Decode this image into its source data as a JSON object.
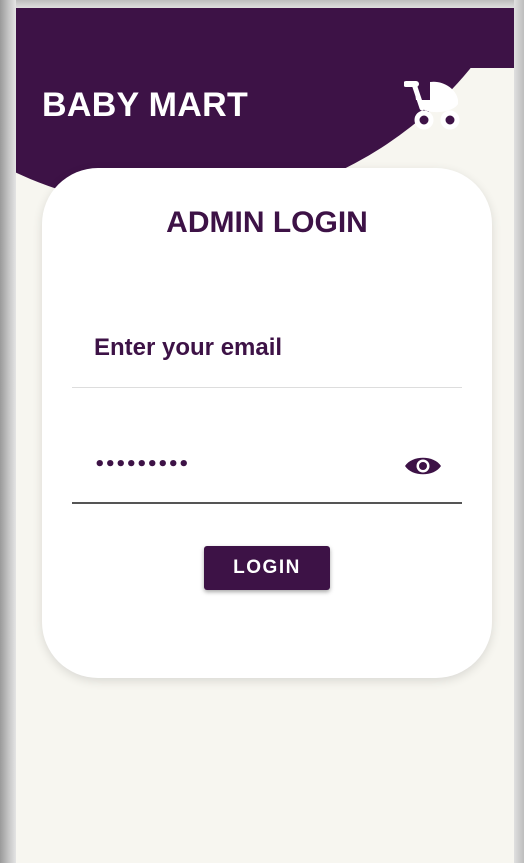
{
  "header": {
    "brand": "BABY MART",
    "cart_icon": "baby-stroller-icon"
  },
  "login": {
    "title": "ADMIN LOGIN",
    "email_placeholder": "Enter your email",
    "password_masked": "•••••••••",
    "password_toggle_icon": "eye-icon",
    "button_label": "LOGIN"
  },
  "colors": {
    "primary": "#3d1246",
    "background": "#f7f6f0",
    "card": "#ffffff"
  }
}
